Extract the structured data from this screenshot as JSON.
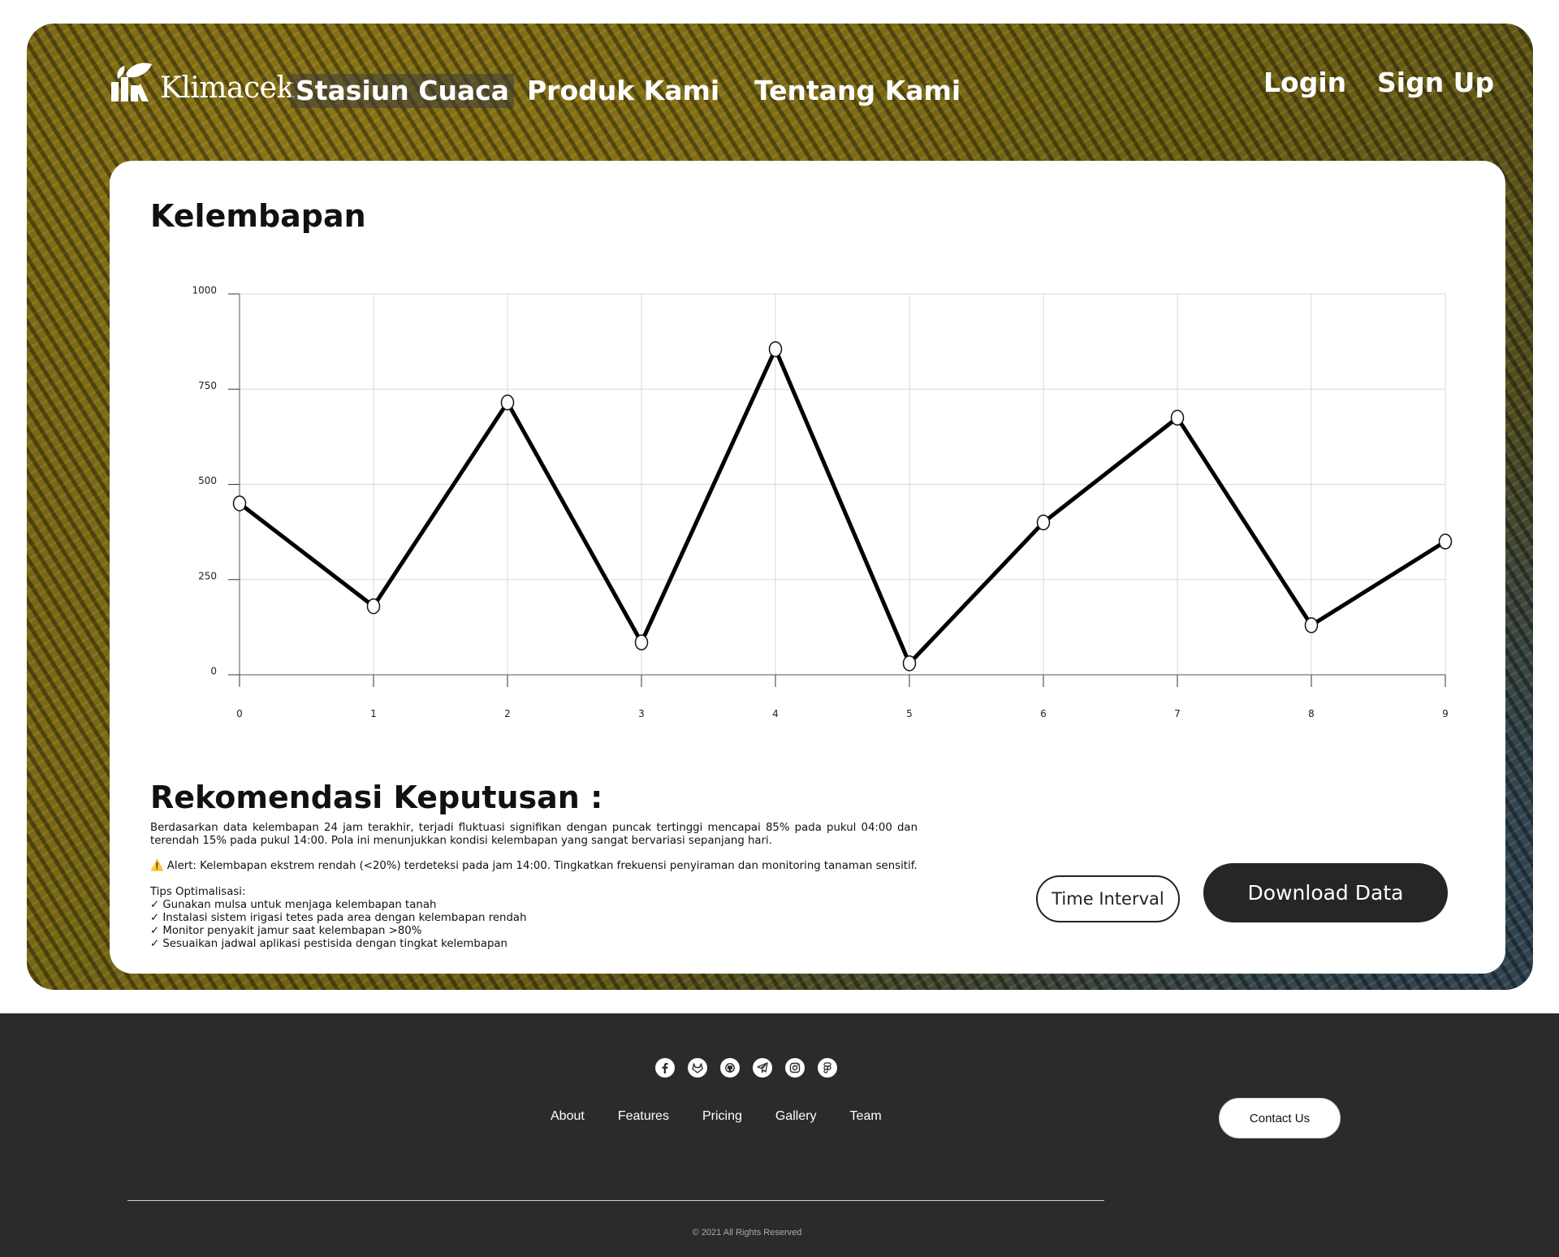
{
  "brand": {
    "name": "Klimacek",
    "logo_icon": "leaf-bars-logo-icon"
  },
  "nav": {
    "items": [
      {
        "label": "Stasiun Cuaca",
        "active": true
      },
      {
        "label": "Produk Kami",
        "active": false
      },
      {
        "label": "Tentang Kami",
        "active": false
      }
    ],
    "login": "Login",
    "signup": "Sign Up"
  },
  "card": {
    "title": "Kelembapan"
  },
  "chart_data": {
    "type": "line",
    "title": "Kelembapan",
    "x": [
      0,
      1,
      2,
      3,
      4,
      5,
      6,
      7,
      8,
      9
    ],
    "y": [
      450,
      180,
      715,
      85,
      855,
      30,
      400,
      675,
      130,
      350
    ],
    "xlim": [
      0,
      9
    ],
    "ylim": [
      0,
      1000
    ],
    "x_ticks": [
      "0",
      "1",
      "2",
      "3",
      "4",
      "5",
      "6",
      "7",
      "8",
      "9"
    ],
    "y_ticks": [
      1000,
      750,
      500,
      250,
      0
    ],
    "grid": true,
    "line_color": "#000000",
    "marker": "hollow-circle"
  },
  "recommendation": {
    "title": "Rekomendasi Keputusan :",
    "summary": "Berdasarkan data kelembapan 24 jam terakhir, terjadi fluktuasi signifikan dengan puncak tertinggi mencapai 85% pada pukul 04:00 dan terendah 15% pada pukul 14:00. Pola ini menunjukkan kondisi kelembapan yang sangat bervariasi sepanjang hari.",
    "alert": "⚠️ Alert: Kelembapan ekstrem rendah (<20%) terdeteksi pada jam 14:00. Tingkatkan frekuensi penyiraman dan monitoring tanaman sensitif.",
    "tips_title": "Tips Optimalisasi:",
    "tips": [
      "✓ Gunakan mulsa untuk menjaga kelembapan tanah",
      "✓ Instalasi sistem irigasi tetes pada area dengan kelembapan rendah",
      "✓ Monitor penyakit jamur saat kelembapan >80%",
      "✓ Sesuaikan jadwal aplikasi pestisida dengan tingkat kelembapan"
    ]
  },
  "buttons": {
    "time_interval": "Time Interval",
    "download": "Download Data"
  },
  "footer": {
    "socials": [
      "facebook-icon",
      "gitlab-icon",
      "github-icon",
      "telegram-icon",
      "instagram-icon",
      "figma-icon"
    ],
    "links": [
      "About",
      "Features",
      "Pricing",
      "Gallery",
      "Team"
    ],
    "contact": "Contact Us",
    "copyright": "© 2021 All Rights Reserved"
  }
}
